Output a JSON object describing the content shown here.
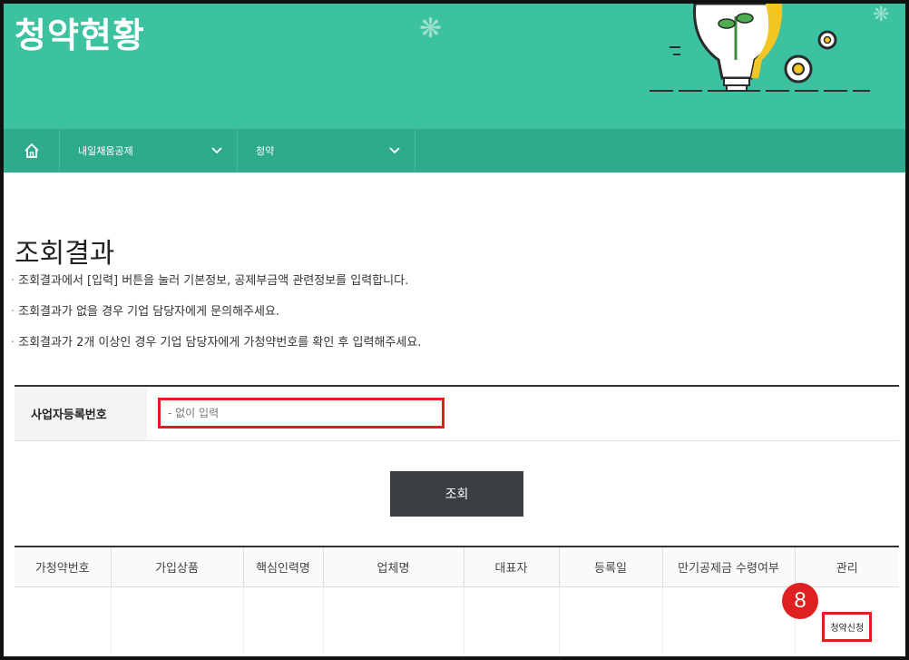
{
  "banner": {
    "title": "청약현황"
  },
  "nav": {
    "menu1": "내일채움공제",
    "menu2": "청약"
  },
  "content": {
    "title": "조회결과",
    "notes": [
      "조회결과에서 [입력] 버튼을 눌러 기본정보, 공제부금액 관련정보를 입력합니다.",
      "조회결과가 없을 경우 기업 담당자에게 문의해주세요.",
      "조회결과가 2개 이상인 경우 기업 담당자에게 가청약번호를 확인 후 입력해주세요."
    ]
  },
  "search": {
    "label": "사업자등록번호",
    "placeholder": "- 없이 입력"
  },
  "query_button": "조회",
  "table": {
    "headers": [
      "가청약번호",
      "가입상품",
      "핵심인력명",
      "업체명",
      "대표자",
      "등록일",
      "만기공제금 수령여부",
      "관리"
    ],
    "row": {
      "action": "청약신청"
    }
  },
  "annotation": {
    "step": "8"
  },
  "colors": {
    "banner": "#3cc2a1",
    "navbar": "#2eaa8c",
    "highlight": "#e02020",
    "button": "#3a3f44"
  }
}
